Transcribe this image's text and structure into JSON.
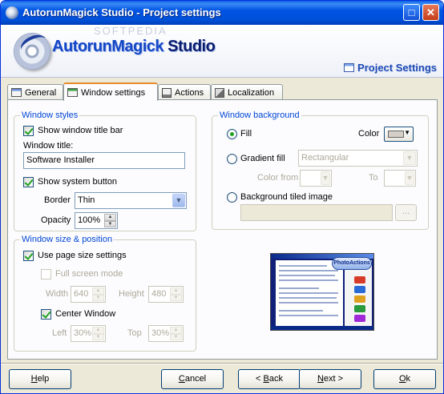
{
  "window": {
    "title": "AutorunMagick Studio - Project settings"
  },
  "header": {
    "logo_part1": "AutorunMagick",
    "logo_part2": " Studio",
    "watermark": "SOFTPEDIA",
    "page_title": "Project Settings"
  },
  "tabs": [
    {
      "label": "General"
    },
    {
      "label": "Window settings"
    },
    {
      "label": "Actions"
    },
    {
      "label": "Localization"
    }
  ],
  "window_styles": {
    "title": "Window styles",
    "show_title_bar": {
      "label": "Show window title bar",
      "checked": true
    },
    "window_title_label": "Window title:",
    "window_title_value": "Software Installer",
    "show_system_button": {
      "label": "Show system button",
      "checked": true
    },
    "border_label": "Border",
    "border_value": "Thin",
    "opacity_label": "Opacity",
    "opacity_value": "100%"
  },
  "window_size": {
    "title": "Window size & position",
    "use_page_size": {
      "label": "Use page size settings",
      "checked": true
    },
    "full_screen": {
      "label": "Full screen mode",
      "checked": false
    },
    "width_label": "Width",
    "width_value": "640",
    "height_label": "Height",
    "height_value": "480",
    "center_window": {
      "label": "Center Window",
      "checked": true
    },
    "left_label": "Left",
    "left_value": "30%",
    "top_label": "Top",
    "top_value": "30%"
  },
  "window_background": {
    "title": "Window background",
    "fill_label": "Fill",
    "color_label": "Color",
    "gradient_label": "Gradient fill",
    "gradient_type": "Rectangular",
    "color_from_label": "Color from",
    "to_label": "To",
    "tiled_label": "Background tiled image",
    "browse_label": "...",
    "selected": "fill"
  },
  "preview": {
    "logo_text": "PhotoActions"
  },
  "buttons": {
    "help": {
      "hotkey": "H",
      "rest": "elp"
    },
    "cancel": {
      "hotkey": "C",
      "rest": "ancel"
    },
    "back": {
      "prefix": "< ",
      "hotkey": "B",
      "rest": "ack"
    },
    "next": {
      "hotkey": "N",
      "rest": "ext >"
    },
    "ok": {
      "hotkey": "O",
      "rest": "k"
    }
  },
  "colors": {
    "title_bar": "#0054e3",
    "accent": "#0046d5",
    "tab_highlight": "#e68b2c",
    "check_green": "#21a121",
    "fill_color": "#d4d0c8"
  }
}
